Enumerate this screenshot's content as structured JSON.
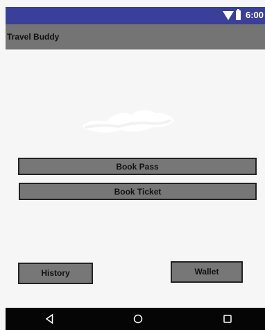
{
  "status_bar": {
    "time": "6:00",
    "wifi_icon": "wifi-icon",
    "battery_icon": "battery-icon",
    "color": "#3a3f99"
  },
  "app_bar": {
    "title": "Travel Buddy",
    "color": "#747474"
  },
  "main": {
    "image_icon": "cloud-icon",
    "buttons": [
      {
        "label": "Book Pass"
      },
      {
        "label": "Book Ticket"
      }
    ],
    "bottom_buttons": [
      {
        "label": "History"
      },
      {
        "label": "Wallet"
      }
    ]
  },
  "nav_bar": {
    "back_icon": "back-triangle-icon",
    "home_icon": "home-circle-icon",
    "recents_icon": "recents-square-icon",
    "color": "#050505"
  },
  "colors": {
    "background": "#f6f6f6",
    "button_fill": "#777777",
    "button_border": "#222222",
    "icon_white": "#ffffff"
  }
}
